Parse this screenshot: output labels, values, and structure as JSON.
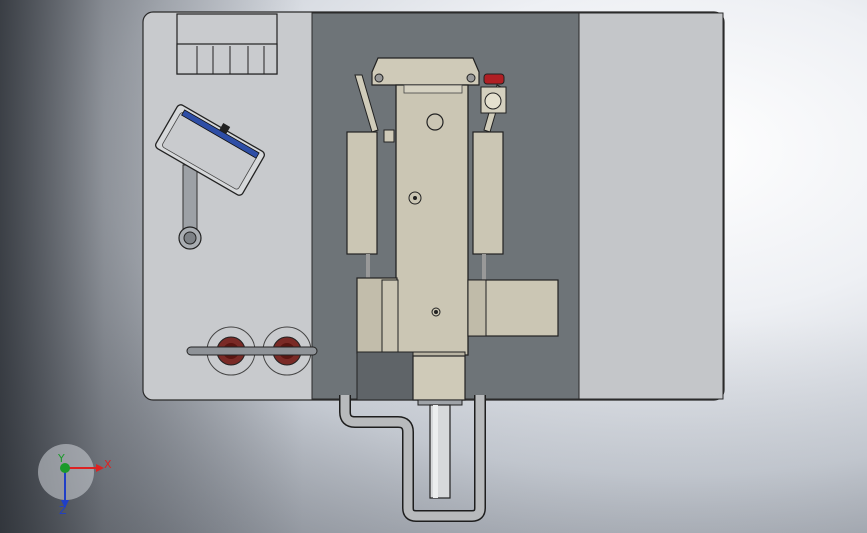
{
  "triad": {
    "x_label": "X",
    "y_label": "Y",
    "z_label": "Z"
  },
  "colors": {
    "base_plate": "#c8cacd",
    "machine_bed": "#6e7478",
    "right_panel": "#bfc1c4",
    "machine_body": "#cbc6b4",
    "tube": "#b8babc",
    "emergency_stop": "#b01f24",
    "blue_stripe": "#2e4ea6",
    "axis_x": "#d22",
    "axis_y": "#1a9a2a",
    "axis_z": "#1f3fc8"
  }
}
